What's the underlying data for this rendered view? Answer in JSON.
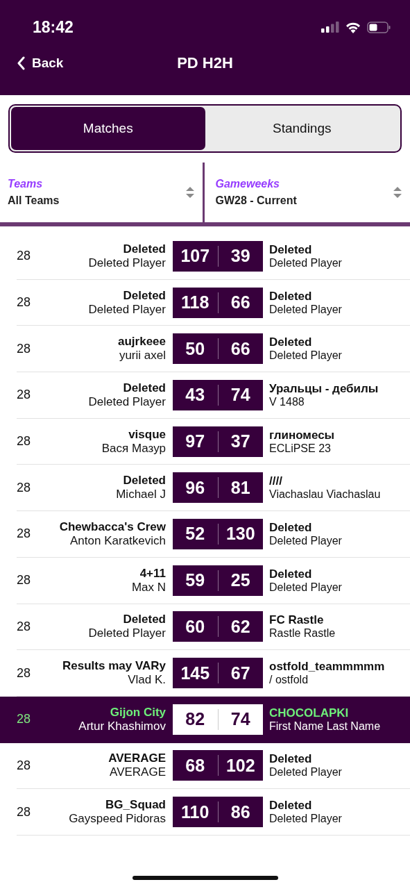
{
  "status_bar": {
    "time": "18:42"
  },
  "nav": {
    "back": "Back",
    "title": "PD H2H"
  },
  "tabs": [
    {
      "label": "Matches",
      "selected": true
    },
    {
      "label": "Standings",
      "selected": false
    }
  ],
  "filters": [
    {
      "label": "Teams",
      "value": "All Teams"
    },
    {
      "label": "Gameweeks",
      "value": "GW28 - Current"
    }
  ],
  "matches": [
    {
      "gw": "28",
      "home_team": "Deleted",
      "home_manager": "Deleted Player",
      "home_score": "107",
      "away_score": "39",
      "away_team": "Deleted",
      "away_manager": "Deleted Player",
      "highlighted": false
    },
    {
      "gw": "28",
      "home_team": "Deleted",
      "home_manager": "Deleted Player",
      "home_score": "118",
      "away_score": "66",
      "away_team": "Deleted",
      "away_manager": "Deleted Player",
      "highlighted": false
    },
    {
      "gw": "28",
      "home_team": "aujrkeee",
      "home_manager": "yurii axel",
      "home_score": "50",
      "away_score": "66",
      "away_team": "Deleted",
      "away_manager": "Deleted Player",
      "highlighted": false
    },
    {
      "gw": "28",
      "home_team": "Deleted",
      "home_manager": "Deleted Player",
      "home_score": "43",
      "away_score": "74",
      "away_team": "Уральцы - дебилы",
      "away_manager": "V 1488",
      "highlighted": false
    },
    {
      "gw": "28",
      "home_team": "visque",
      "home_manager": "Вася Мазур",
      "home_score": "97",
      "away_score": "37",
      "away_team": "глиномесы",
      "away_manager": "ECLiPSE 23",
      "highlighted": false
    },
    {
      "gw": "28",
      "home_team": "Deleted",
      "home_manager": "Michael J",
      "home_score": "96",
      "away_score": "81",
      "away_team": "////",
      "away_manager": "Viachaslau Viachaslau",
      "highlighted": false
    },
    {
      "gw": "28",
      "home_team": "Chewbacca's Crew",
      "home_manager": "Anton Karatkevich",
      "home_score": "52",
      "away_score": "130",
      "away_team": "Deleted",
      "away_manager": "Deleted Player",
      "highlighted": false
    },
    {
      "gw": "28",
      "home_team": "4+11",
      "home_manager": "Max N",
      "home_score": "59",
      "away_score": "25",
      "away_team": "Deleted",
      "away_manager": "Deleted Player",
      "highlighted": false
    },
    {
      "gw": "28",
      "home_team": "Deleted",
      "home_manager": "Deleted Player",
      "home_score": "60",
      "away_score": "62",
      "away_team": "FC Rastle",
      "away_manager": "Rastle Rastle",
      "highlighted": false
    },
    {
      "gw": "28",
      "home_team": "Results may VARy",
      "home_manager": "Vlad K.",
      "home_score": "145",
      "away_score": "67",
      "away_team": "ostfold_teammmmm",
      "away_manager": "/ ostfold",
      "highlighted": false
    },
    {
      "gw": "28",
      "home_team": "Gijon City",
      "home_manager": "Artur Khashimov",
      "home_score": "82",
      "away_score": "74",
      "away_team": "CHOCOLAPKI",
      "away_manager": "First Name Last Name",
      "highlighted": true
    },
    {
      "gw": "28",
      "home_team": "AVERAGE",
      "home_manager": "AVERAGE",
      "home_score": "68",
      "away_score": "102",
      "away_team": "Deleted",
      "away_manager": "Deleted Player",
      "highlighted": false
    },
    {
      "gw": "28",
      "home_team": "BG_Squad",
      "home_manager": "Gayspeed Pidoras",
      "home_score": "110",
      "away_score": "86",
      "away_team": "Deleted",
      "away_manager": "Deleted Player",
      "highlighted": false
    }
  ]
}
